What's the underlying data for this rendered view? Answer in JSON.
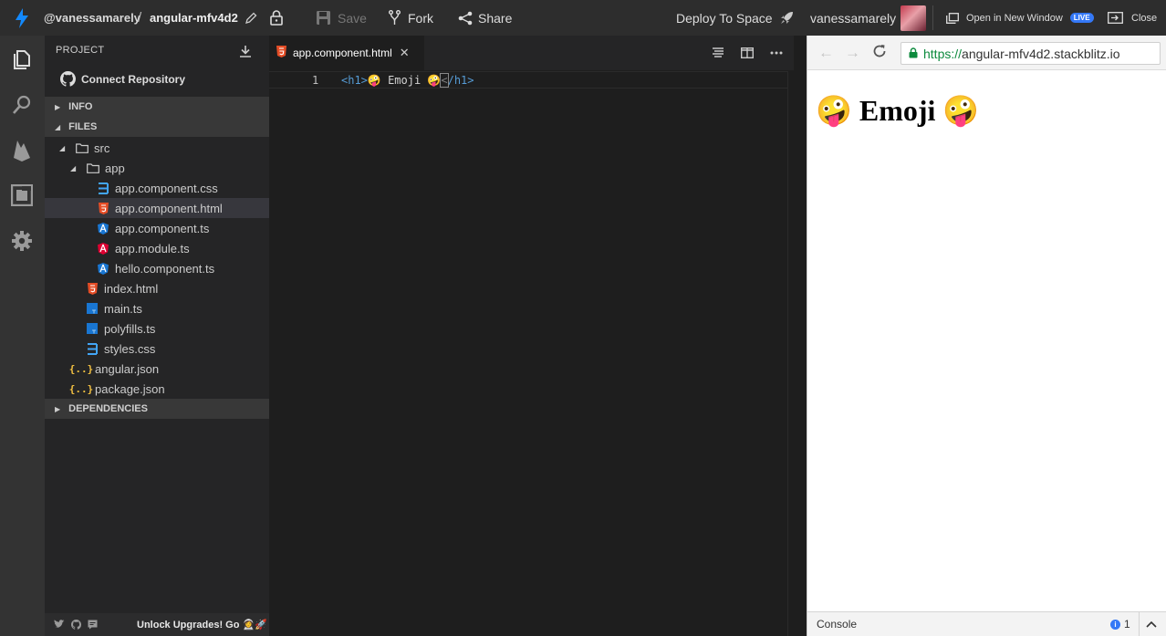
{
  "topbar": {
    "username": "@vanessamarely",
    "separator": "/",
    "project_name": "angular-mfv4d2",
    "save_label": "Save",
    "fork_label": "Fork",
    "share_label": "Share",
    "deploy_label": "Deploy To Space",
    "account_name": "vanessamarely",
    "open_window_label": "Open in New Window",
    "live_badge": "LIVE",
    "close_label": "Close"
  },
  "activity_bar": {
    "icons": [
      "files-icon",
      "search-icon",
      "firebase-icon",
      "extensions-icon",
      "settings-gear-icon"
    ]
  },
  "sidebar": {
    "header": "PROJECT",
    "connect_repo": "Connect Repository",
    "sections": {
      "info": "INFO",
      "files": "FILES",
      "dependencies": "DEPENDENCIES"
    },
    "tree": [
      {
        "name": "src",
        "type": "folder"
      },
      {
        "name": "app",
        "type": "folder"
      },
      {
        "name": "app.component.css",
        "type": "css"
      },
      {
        "name": "app.component.html",
        "type": "html",
        "selected": true
      },
      {
        "name": "app.component.ts",
        "type": "angular-ts"
      },
      {
        "name": "app.module.ts",
        "type": "angular"
      },
      {
        "name": "hello.component.ts",
        "type": "angular-ts"
      },
      {
        "name": "index.html",
        "type": "html"
      },
      {
        "name": "main.ts",
        "type": "ts"
      },
      {
        "name": "polyfills.ts",
        "type": "ts"
      },
      {
        "name": "styles.css",
        "type": "css"
      },
      {
        "name": "angular.json",
        "type": "json"
      },
      {
        "name": "package.json",
        "type": "json"
      }
    ],
    "footer": {
      "upgrade_text": "Unlock Upgrades! Go 👩‍🚀🚀"
    }
  },
  "editor": {
    "active_tab": "app.component.html",
    "line_number": "1",
    "code": {
      "open_tag": "<h1>",
      "content": "🤪 Emoji 🤪",
      "close_lt": "<",
      "close_tag": "/h1>"
    }
  },
  "preview": {
    "url_scheme": "https://",
    "url_host": "angular-mfv4d2.stackblitz.io",
    "heading": "🤪 Emoji 🤪",
    "console_label": "Console",
    "console_count": "1"
  },
  "colors": {
    "accent_blue": "#3478f6",
    "html_icon": "#e44d26",
    "css_icon": "#42a5f5",
    "angular_icon": "#dd0031",
    "json_icon": "#f5c242",
    "https_green": "#0c8a3d"
  }
}
